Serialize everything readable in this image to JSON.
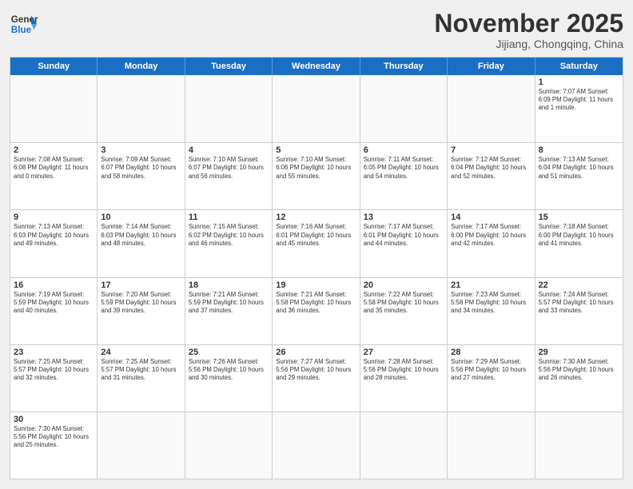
{
  "header": {
    "logo_general": "General",
    "logo_blue": "Blue",
    "month": "November 2025",
    "location": "Jijiang, Chongqing, China"
  },
  "days": [
    "Sunday",
    "Monday",
    "Tuesday",
    "Wednesday",
    "Thursday",
    "Friday",
    "Saturday"
  ],
  "weeks": [
    [
      {
        "day": "",
        "info": ""
      },
      {
        "day": "",
        "info": ""
      },
      {
        "day": "",
        "info": ""
      },
      {
        "day": "",
        "info": ""
      },
      {
        "day": "",
        "info": ""
      },
      {
        "day": "",
        "info": ""
      },
      {
        "day": "1",
        "info": "Sunrise: 7:07 AM\nSunset: 6:09 PM\nDaylight: 11 hours and 1 minute."
      }
    ],
    [
      {
        "day": "2",
        "info": "Sunrise: 7:08 AM\nSunset: 6:08 PM\nDaylight: 11 hours and 0 minutes."
      },
      {
        "day": "3",
        "info": "Sunrise: 7:09 AM\nSunset: 6:07 PM\nDaylight: 10 hours and 58 minutes."
      },
      {
        "day": "4",
        "info": "Sunrise: 7:10 AM\nSunset: 6:07 PM\nDaylight: 10 hours and 56 minutes."
      },
      {
        "day": "5",
        "info": "Sunrise: 7:10 AM\nSunset: 6:06 PM\nDaylight: 10 hours and 55 minutes."
      },
      {
        "day": "6",
        "info": "Sunrise: 7:11 AM\nSunset: 6:05 PM\nDaylight: 10 hours and 54 minutes."
      },
      {
        "day": "7",
        "info": "Sunrise: 7:12 AM\nSunset: 6:04 PM\nDaylight: 10 hours and 52 minutes."
      },
      {
        "day": "8",
        "info": "Sunrise: 7:13 AM\nSunset: 6:04 PM\nDaylight: 10 hours and 51 minutes."
      }
    ],
    [
      {
        "day": "9",
        "info": "Sunrise: 7:13 AM\nSunset: 6:03 PM\nDaylight: 10 hours and 49 minutes."
      },
      {
        "day": "10",
        "info": "Sunrise: 7:14 AM\nSunset: 6:03 PM\nDaylight: 10 hours and 48 minutes."
      },
      {
        "day": "11",
        "info": "Sunrise: 7:15 AM\nSunset: 6:02 PM\nDaylight: 10 hours and 46 minutes."
      },
      {
        "day": "12",
        "info": "Sunrise: 7:16 AM\nSunset: 6:01 PM\nDaylight: 10 hours and 45 minutes."
      },
      {
        "day": "13",
        "info": "Sunrise: 7:17 AM\nSunset: 6:01 PM\nDaylight: 10 hours and 44 minutes."
      },
      {
        "day": "14",
        "info": "Sunrise: 7:17 AM\nSunset: 6:00 PM\nDaylight: 10 hours and 42 minutes."
      },
      {
        "day": "15",
        "info": "Sunrise: 7:18 AM\nSunset: 6:00 PM\nDaylight: 10 hours and 41 minutes."
      }
    ],
    [
      {
        "day": "16",
        "info": "Sunrise: 7:19 AM\nSunset: 5:59 PM\nDaylight: 10 hours and 40 minutes."
      },
      {
        "day": "17",
        "info": "Sunrise: 7:20 AM\nSunset: 5:59 PM\nDaylight: 10 hours and 39 minutes."
      },
      {
        "day": "18",
        "info": "Sunrise: 7:21 AM\nSunset: 5:59 PM\nDaylight: 10 hours and 37 minutes."
      },
      {
        "day": "19",
        "info": "Sunrise: 7:21 AM\nSunset: 5:58 PM\nDaylight: 10 hours and 36 minutes."
      },
      {
        "day": "20",
        "info": "Sunrise: 7:22 AM\nSunset: 5:58 PM\nDaylight: 10 hours and 35 minutes."
      },
      {
        "day": "21",
        "info": "Sunrise: 7:23 AM\nSunset: 5:58 PM\nDaylight: 10 hours and 34 minutes."
      },
      {
        "day": "22",
        "info": "Sunrise: 7:24 AM\nSunset: 5:57 PM\nDaylight: 10 hours and 33 minutes."
      }
    ],
    [
      {
        "day": "23",
        "info": "Sunrise: 7:25 AM\nSunset: 5:57 PM\nDaylight: 10 hours and 32 minutes."
      },
      {
        "day": "24",
        "info": "Sunrise: 7:25 AM\nSunset: 5:57 PM\nDaylight: 10 hours and 31 minutes."
      },
      {
        "day": "25",
        "info": "Sunrise: 7:26 AM\nSunset: 5:56 PM\nDaylight: 10 hours and 30 minutes."
      },
      {
        "day": "26",
        "info": "Sunrise: 7:27 AM\nSunset: 5:56 PM\nDaylight: 10 hours and 29 minutes."
      },
      {
        "day": "27",
        "info": "Sunrise: 7:28 AM\nSunset: 5:56 PM\nDaylight: 10 hours and 28 minutes."
      },
      {
        "day": "28",
        "info": "Sunrise: 7:29 AM\nSunset: 5:56 PM\nDaylight: 10 hours and 27 minutes."
      },
      {
        "day": "29",
        "info": "Sunrise: 7:30 AM\nSunset: 5:56 PM\nDaylight: 10 hours and 26 minutes."
      }
    ],
    [
      {
        "day": "30",
        "info": "Sunrise: 7:30 AM\nSunset: 5:56 PM\nDaylight: 10 hours and 25 minutes."
      },
      {
        "day": "",
        "info": ""
      },
      {
        "day": "",
        "info": ""
      },
      {
        "day": "",
        "info": ""
      },
      {
        "day": "",
        "info": ""
      },
      {
        "day": "",
        "info": ""
      },
      {
        "day": "",
        "info": ""
      }
    ]
  ]
}
